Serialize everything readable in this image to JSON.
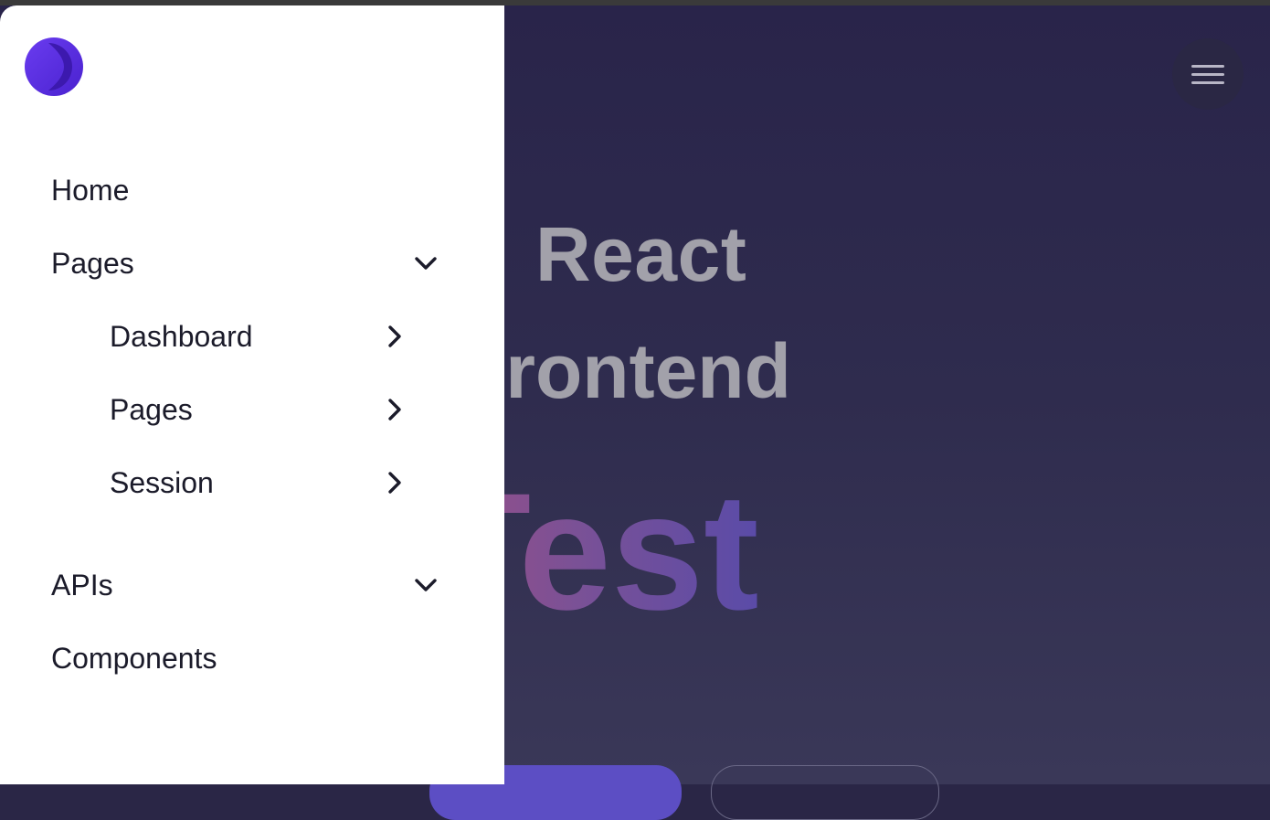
{
  "hero": {
    "line1": "React",
    "line2": "Frontend",
    "line3": "Test"
  },
  "header": {
    "menu_icon": "hamburger-menu-icon"
  },
  "drawer": {
    "logo_icon": "crescent-logo-icon",
    "items": [
      {
        "label": "Home"
      },
      {
        "label": "Pages",
        "icon": "chevron-down-icon",
        "expanded": true,
        "children": [
          {
            "label": "Dashboard",
            "icon": "chevron-right-icon"
          },
          {
            "label": "Pages",
            "icon": "chevron-right-icon"
          },
          {
            "label": "Session",
            "icon": "chevron-right-icon"
          }
        ]
      },
      {
        "label": "APIs",
        "icon": "chevron-down-icon"
      },
      {
        "label": "Components"
      }
    ]
  },
  "colors": {
    "accent": "#5b2fe0",
    "background": "#29244a",
    "drawer": "#ffffff",
    "text": "#1b1b2a"
  }
}
